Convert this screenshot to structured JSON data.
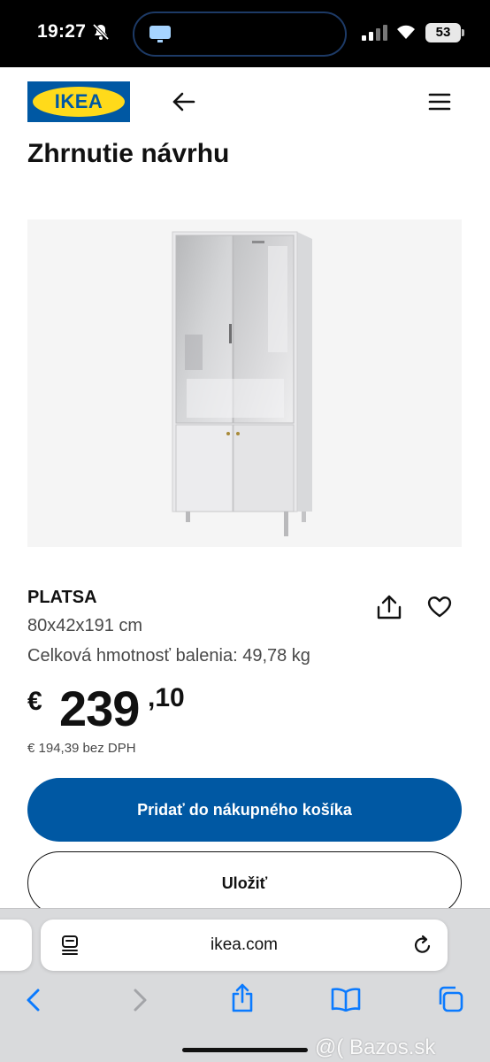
{
  "status_bar": {
    "time": "19:27",
    "battery": "53"
  },
  "header": {
    "logo_text": "IKEA",
    "title": "Zhrnutie návrhu"
  },
  "product": {
    "name": "PLATSA",
    "dimensions": "80x42x191 cm",
    "weight": "Celková hmotnosť balenia: 49,78 kg",
    "price": {
      "currency": "€",
      "integer": "239",
      "decimal": ",10"
    },
    "price_excl_vat": "€ 194,39 bez DPH"
  },
  "actions": {
    "add_to_cart_label": "Pridať do nákupného košíka",
    "save_label": "Uložiť"
  },
  "browser": {
    "address": "ikea.com"
  },
  "watermark": "@( Bazos.sk",
  "colors": {
    "brand_blue": "#0058a3",
    "brand_yellow": "#ffda1a",
    "text": "#111111",
    "muted_text": "#484848"
  },
  "icons": {
    "back": "arrow-left-icon",
    "menu": "hamburger-menu-icon",
    "share": "share-icon",
    "wishlist": "heart-icon",
    "reader": "reader-mode-icon",
    "reload": "reload-icon"
  }
}
